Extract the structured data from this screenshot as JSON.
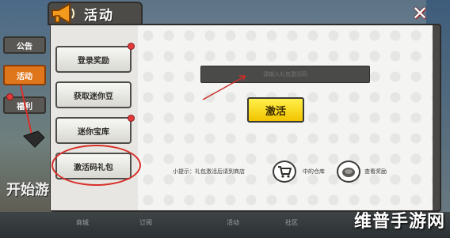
{
  "header": {
    "title": "活动",
    "close_label": "✕"
  },
  "side_tabs": [
    {
      "label": "公告"
    },
    {
      "label": "活动"
    },
    {
      "label": "福利"
    }
  ],
  "start_text": "开始游",
  "nav": [
    {
      "label": "登录奖励",
      "badge": true
    },
    {
      "label": "获取迷你豆",
      "badge": false
    },
    {
      "label": "迷你宝库",
      "badge": true
    },
    {
      "label": "激活码礼包",
      "badge": false
    }
  ],
  "content": {
    "code_input_placeholder": "请输入礼包激活码",
    "activate_label": "激活",
    "tip_prefix": "小提示：礼包激活后请到商店",
    "tip_middle": "中的仓库",
    "tip_end": "查看奖励"
  },
  "bottom_bar": [
    {
      "label": "商城"
    },
    {
      "label": "订阅"
    },
    {
      "label": "活动"
    },
    {
      "label": "社区"
    }
  ],
  "watermark": "维普手游网",
  "colors": {
    "accent": "#e0761c",
    "activate": "#f2c400",
    "highlight": "#d9302a"
  }
}
